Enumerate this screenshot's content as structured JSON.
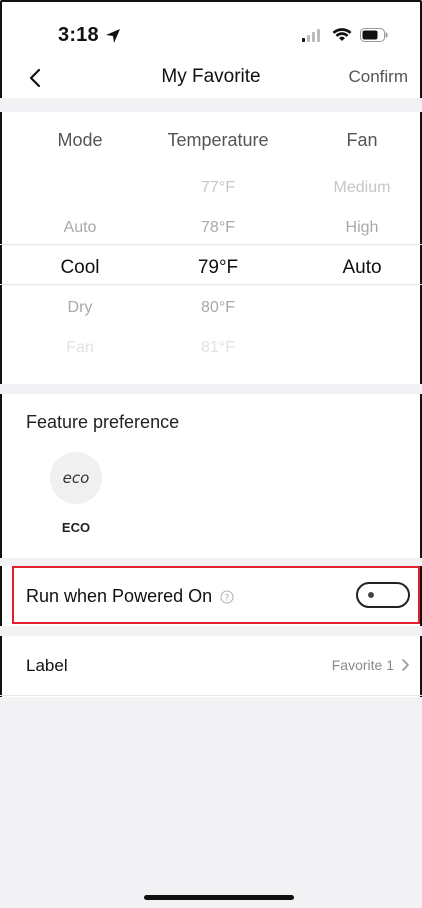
{
  "status": {
    "time": "3:18"
  },
  "nav": {
    "title": "My Favorite",
    "confirm": "Confirm"
  },
  "picker": {
    "headers": [
      "Mode",
      "Temperature",
      "Fan"
    ],
    "mode": [
      "",
      "Auto",
      "Cool",
      "Dry",
      "Fan"
    ],
    "temperature": [
      "77°F",
      "78°F",
      "79°F",
      "80°F",
      "81°F"
    ],
    "fan": [
      "Medium",
      "High",
      "Auto",
      "",
      ""
    ],
    "selected": {
      "mode": "Cool",
      "temperature": "79°F",
      "fan": "Auto"
    }
  },
  "feature": {
    "title": "Feature preference",
    "eco_label": "ECO",
    "eco_glyph": "eco"
  },
  "run_when_powered_on": {
    "label": "Run when Powered On",
    "enabled": false
  },
  "label_row": {
    "label": "Label",
    "value": "Favorite 1"
  },
  "colors": {
    "highlight": "#e0202c",
    "band": "#f2f2f4"
  }
}
